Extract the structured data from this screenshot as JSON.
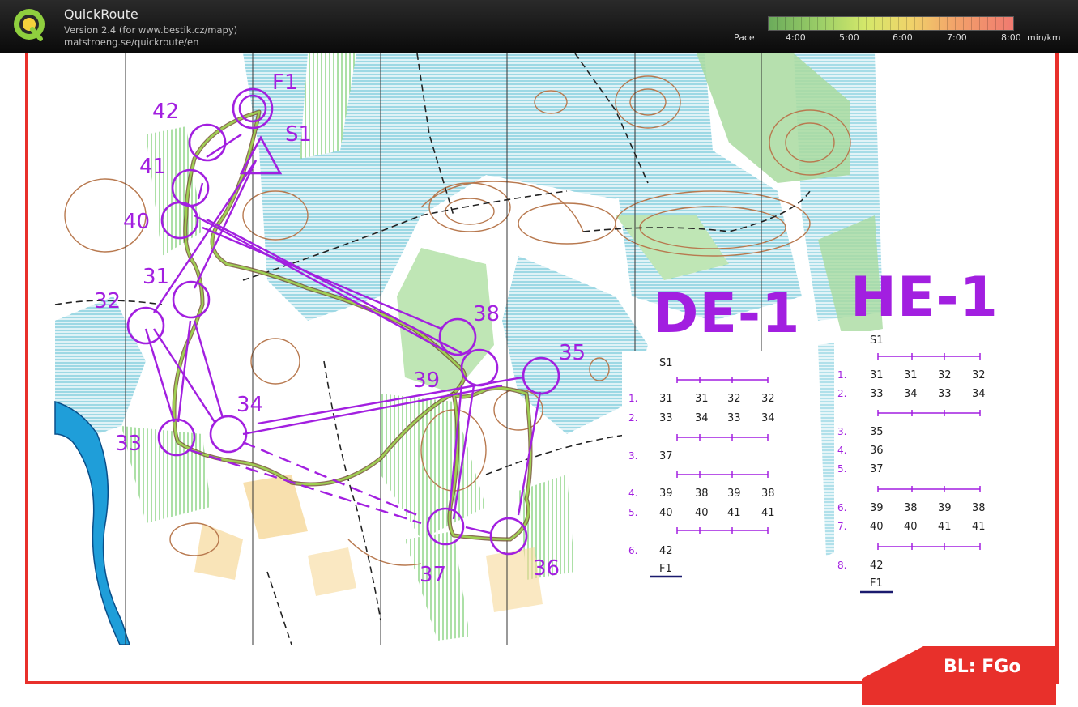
{
  "app": {
    "title": "QuickRoute",
    "version": "Version 2.4  (for www.bestik.cz/mapy)",
    "url": "matstroeng.se/quickroute/en"
  },
  "pace_scale": {
    "label": "Pace",
    "ticks": [
      "4:00",
      "5:00",
      "6:00",
      "7:00",
      "8:00"
    ],
    "unit": "min/km"
  },
  "map": {
    "control_labels": {
      "F1": "F1",
      "S1": "S1",
      "42": "42",
      "41": "41",
      "40": "40",
      "31": "31",
      "32": "32",
      "33": "33",
      "34": "34",
      "38": "38",
      "39": "39",
      "35": "35",
      "37": "37",
      "36": "36"
    },
    "courses": [
      {
        "title": "DE-1",
        "start": "S1",
        "rows": [
          {
            "num": "1.",
            "vals": [
              "31",
              "31",
              "32",
              "32"
            ]
          },
          {
            "num": "2.",
            "vals": [
              "33",
              "34",
              "33",
              "34"
            ]
          },
          {
            "num": "3.",
            "vals": [
              "37"
            ]
          },
          {
            "num": "4.",
            "vals": [
              "39",
              "38",
              "39",
              "38"
            ]
          },
          {
            "num": "5.",
            "vals": [
              "40",
              "40",
              "41",
              "41"
            ]
          },
          {
            "num": "6.",
            "vals": [
              "42"
            ]
          }
        ],
        "finish": "F1"
      },
      {
        "title": "HE-1",
        "start": "S1",
        "rows": [
          {
            "num": "1.",
            "vals": [
              "31",
              "31",
              "32",
              "32"
            ]
          },
          {
            "num": "2.",
            "vals": [
              "33",
              "34",
              "33",
              "34"
            ]
          },
          {
            "num": "3.",
            "vals": [
              "35"
            ]
          },
          {
            "num": "4.",
            "vals": [
              "36"
            ]
          },
          {
            "num": "5.",
            "vals": [
              "37"
            ]
          },
          {
            "num": "6.",
            "vals": [
              "39",
              "38",
              "39",
              "38"
            ]
          },
          {
            "num": "7.",
            "vals": [
              "40",
              "40",
              "41",
              "41"
            ]
          },
          {
            "num": "8.",
            "vals": [
              "42"
            ]
          }
        ],
        "finish": "F1"
      }
    ],
    "footer_badge": "BL: FGo"
  },
  "colors": {
    "course_purple": "#a21fe0",
    "frame_red": "#e8302b",
    "marsh_blue": "#6fc6d8",
    "forest_green": "#a9dba0",
    "contour_brown": "#b8794f",
    "route_green": "#5d8a3a"
  }
}
